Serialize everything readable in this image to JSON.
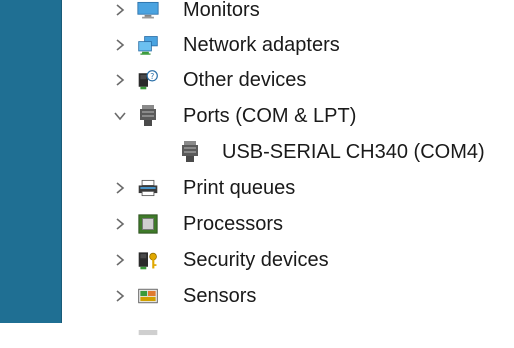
{
  "tree": {
    "items": [
      {
        "label": "Monitors",
        "icon": "monitor-icon",
        "expanded": false
      },
      {
        "label": "Network adapters",
        "icon": "network-adapter-icon",
        "expanded": false
      },
      {
        "label": "Other devices",
        "icon": "other-devices-icon",
        "expanded": false
      },
      {
        "label": "Ports (COM & LPT)",
        "icon": "port-icon",
        "expanded": true,
        "children": [
          {
            "label": "USB-SERIAL CH340 (COM4)",
            "icon": "port-icon"
          }
        ]
      },
      {
        "label": "Print queues",
        "icon": "printer-icon",
        "expanded": false
      },
      {
        "label": "Processors",
        "icon": "processor-icon",
        "expanded": false
      },
      {
        "label": "Security devices",
        "icon": "security-device-icon",
        "expanded": false
      },
      {
        "label": "Sensors",
        "icon": "sensor-icon",
        "expanded": false
      }
    ]
  },
  "colors": {
    "left_strip": "#1f6f93",
    "chevron": "#6b6b6b",
    "text": "#1a1a1a"
  }
}
